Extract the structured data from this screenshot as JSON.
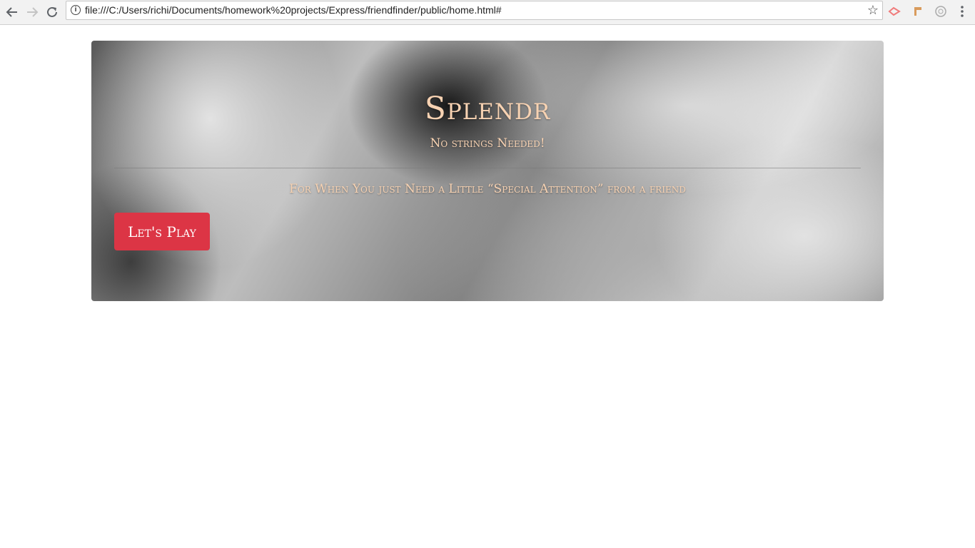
{
  "browser": {
    "url": "file:///C:/Users/richi/Documents/homework%20projects/Express/friendfinder/public/home.html#",
    "icons": {
      "back": "back-arrow-icon",
      "forward": "forward-arrow-icon",
      "reload": "reload-icon",
      "info": "info-icon",
      "bookmark": "star-icon"
    },
    "extensions": [
      "extension-red-icon",
      "extension-orange-icon",
      "extension-grey-icon",
      "menu-dots-icon"
    ]
  },
  "hero": {
    "title": "Splendr",
    "tagline": "No strings Needed!",
    "lead": "For When You just Need a Little “Special Attention” from a friend",
    "button_label": "Let's Play",
    "text_color": "#f7d2b2",
    "button_color": "#dc3545"
  }
}
